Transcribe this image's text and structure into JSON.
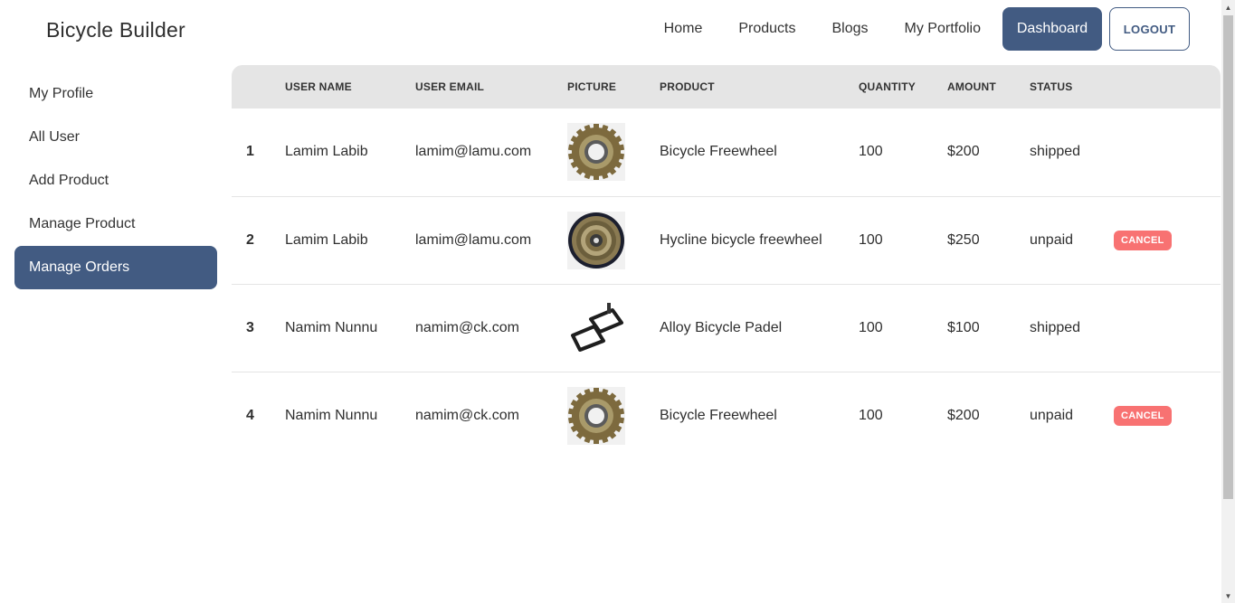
{
  "brand": "Bicycle Builder",
  "nav": {
    "home": "Home",
    "products": "Products",
    "blogs": "Blogs",
    "portfolio": "My Portfolio",
    "dashboard": "Dashboard",
    "logout": "LOGOUT"
  },
  "sidebar": {
    "items": [
      {
        "label": "My Profile"
      },
      {
        "label": "All User"
      },
      {
        "label": "Add Product"
      },
      {
        "label": "Manage Product"
      },
      {
        "label": "Manage Orders",
        "active": true
      }
    ]
  },
  "table": {
    "headers": [
      "",
      "USER NAME",
      "USER EMAIL",
      "PICTURE",
      "PRODUCT",
      "QUANTITY",
      "AMOUNT",
      "STATUS",
      ""
    ],
    "rows": [
      {
        "index": "1",
        "name": "Lamim Labib",
        "email": "lamim@lamu.com",
        "picture": "freewheel-image",
        "product": "Bicycle Freewheel",
        "quantity": "100",
        "amount": "$200",
        "status": "shipped",
        "action": ""
      },
      {
        "index": "2",
        "name": "Lamim Labib",
        "email": "lamim@lamu.com",
        "picture": "cassette-image",
        "product": "Hycline bicycle freewheel",
        "quantity": "100",
        "amount": "$250",
        "status": "unpaid",
        "action": "CANCEL"
      },
      {
        "index": "3",
        "name": "Namim Nunnu",
        "email": "namim@ck.com",
        "picture": "pedal-image",
        "product": "Alloy Bicycle Padel",
        "quantity": "100",
        "amount": "$100",
        "status": "shipped",
        "action": ""
      },
      {
        "index": "4",
        "name": "Namim Nunnu",
        "email": "namim@ck.com",
        "picture": "freewheel-image",
        "product": "Bicycle Freewheel",
        "quantity": "100",
        "amount": "$200",
        "status": "unpaid",
        "action": "CANCEL"
      }
    ]
  },
  "colors": {
    "primary": "#425b82",
    "cancel": "#f87272",
    "header_bg": "#e5e5e5"
  }
}
